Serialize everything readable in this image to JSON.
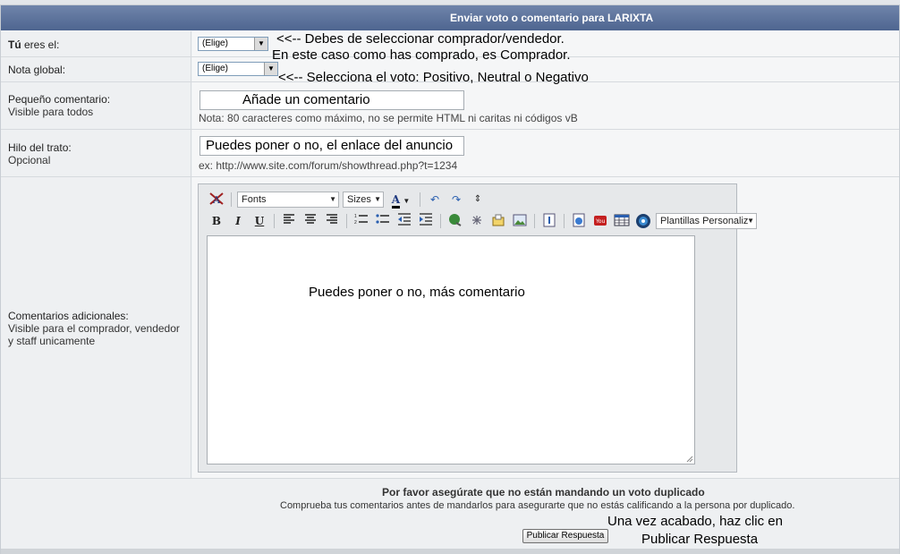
{
  "header": {
    "title": "Enviar voto o comentario para LARIXTA"
  },
  "role": {
    "label_bold": "Tú",
    "label_rest": " eres el:",
    "select_value": "(Elige)",
    "annotation_line1": "<<-- Debes de seleccionar comprador/vendedor.",
    "annotation_line2": "En este caso como has comprado, es Comprador."
  },
  "rating": {
    "label": "Nota global:",
    "select_value": "(Elige)",
    "annotation": "<<-- Selecciona el voto: Positivo, Neutral o Negativo"
  },
  "short_comment": {
    "label": "Pequeño comentario:",
    "sublabel": "Visible para todos",
    "value": "Añade un comentario",
    "hint": "Nota: 80 caracteres como máximo, no se permite HTML ni caritas ni códigos vB"
  },
  "thread": {
    "label": "Hilo del trato:",
    "sublabel": "Opcional",
    "value": "Puedes poner o no, el enlace del anuncio",
    "hint": "ex: http://www.site.com/forum/showthread.php?t=1234"
  },
  "additional": {
    "label": "Comentarios adicionales:",
    "sublabel_1": "Visible para el comprador, vendedor",
    "sublabel_2": "y staff unicamente",
    "editor_text": "Puedes poner o no, más comentario"
  },
  "toolbar": {
    "font_label": "Fonts",
    "size_label": "Sizes",
    "templates_label": "Plantillas Personaliz",
    "bold": "B",
    "italic": "I",
    "underline": "U",
    "font_color": "A"
  },
  "footer": {
    "warning_title": "Por favor asegúrate que no están mandando un voto duplicado",
    "warning_text": "Comprueba tus comentarios antes de mandarlos para asegurarte que no estás calificando a la persona por duplicado.",
    "submit_label": "Publicar Respuesta",
    "annotation_line1": "Una vez acabado, haz clic en",
    "annotation_line2": "Publicar Respuesta"
  }
}
